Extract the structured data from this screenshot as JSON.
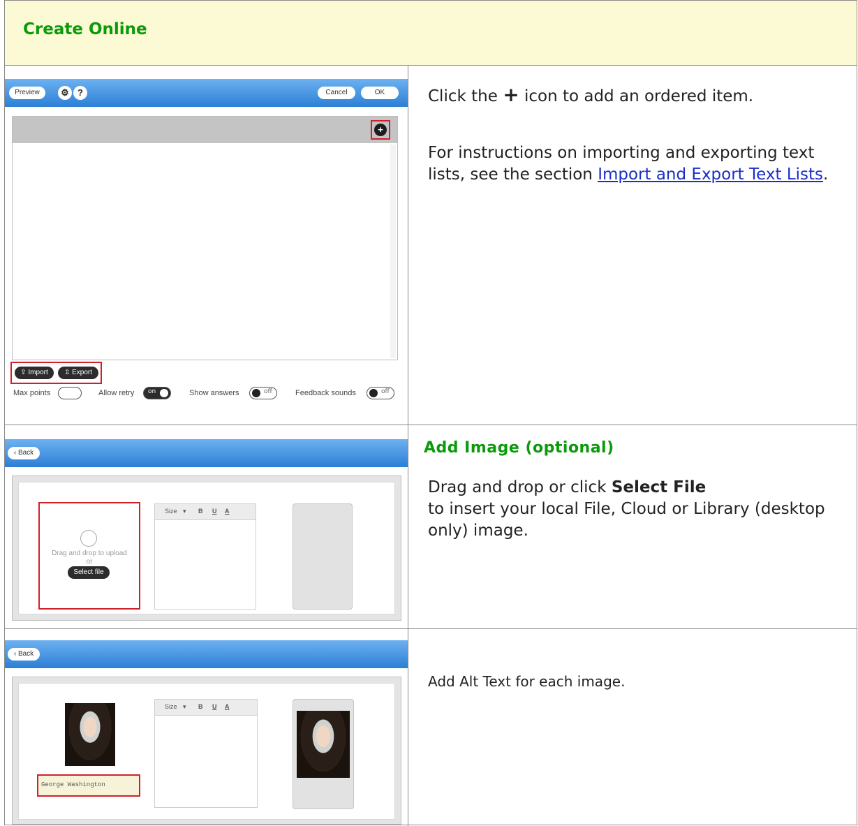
{
  "header": {
    "title": "Create Online"
  },
  "row1": {
    "editor": {
      "preview_label": "Preview",
      "gear_icon": "gear-icon",
      "help_label": "?",
      "cancel_label": "Cancel",
      "ok_label": "OK",
      "add_icon": "+",
      "import_label": "Import",
      "export_label": "Export",
      "options": {
        "max_points_label": "Max points",
        "allow_retry_label": "Allow retry",
        "allow_retry_state": "on",
        "show_answers_label": "Show answers",
        "show_answers_state": "off",
        "feedback_sounds_label": "Feedback sounds",
        "feedback_sounds_state": "off"
      }
    },
    "text": {
      "click_prefix": "Click the",
      "plus_glyph": "+",
      "click_suffix": "icon to add an ordered item.",
      "instructions_prefix": "For instructions on importing and exporting text lists, see the section",
      "link_text": "Import and Export Text Lists",
      "instructions_suffix": "."
    }
  },
  "row2": {
    "editor": {
      "back_label": "Back",
      "drop_text": "Drag and drop to upload",
      "or_text": "or",
      "select_file_label": "Select file",
      "toolbar": {
        "size_label": "Size",
        "bold_label": "B",
        "underline_label": "U",
        "color_label": "A"
      }
    },
    "text": {
      "heading": "Add Image (optional)",
      "line1_prefix": "Drag and drop or click",
      "line1_bold": "Select File",
      "line2": "to insert your local File, Cloud or Library (desktop only) image."
    }
  },
  "row3": {
    "editor": {
      "back_label": "Back",
      "alt_text_value": "George Washington",
      "toolbar": {
        "size_label": "Size",
        "bold_label": "B",
        "underline_label": "U",
        "color_label": "A"
      }
    },
    "text": {
      "line": "Add Alt Text for each image."
    }
  },
  "colors": {
    "heading_green": "#0a9a0a",
    "header_bg": "#fbfad5",
    "toolbar_blue": "#2c7fd6",
    "highlight_red": "#d0202a",
    "link_blue": "#1a2ec8"
  }
}
